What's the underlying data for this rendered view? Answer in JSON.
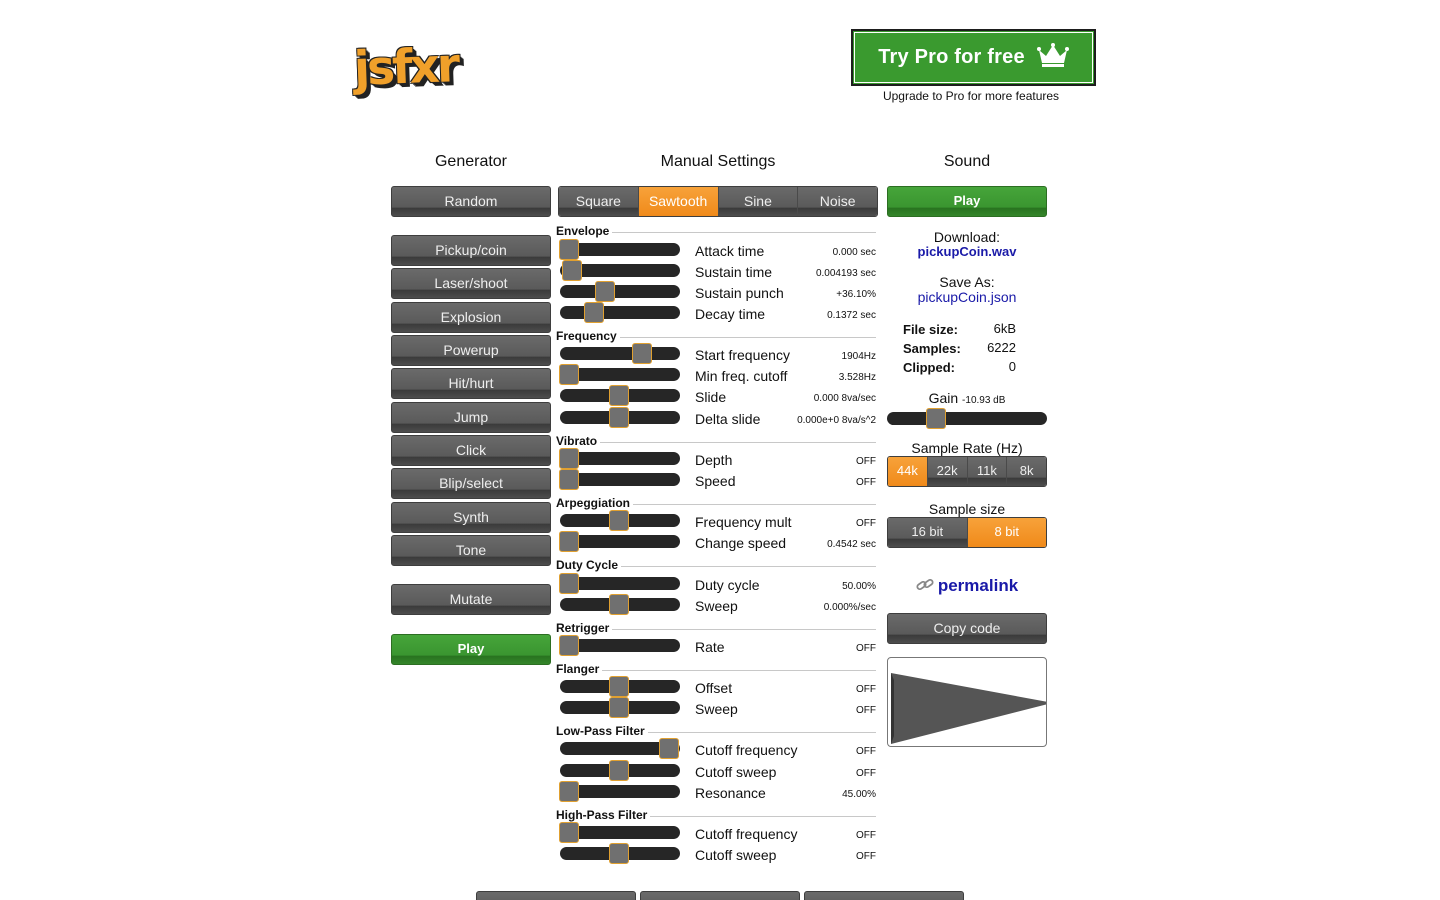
{
  "brand": {
    "logo_text": "jsfxr"
  },
  "pro": {
    "button_label": "Try Pro for free",
    "subtitle": "Upgrade to Pro for more features"
  },
  "headings": {
    "generator": "Generator",
    "manual": "Manual Settings",
    "sound": "Sound"
  },
  "generator": {
    "random": "Random",
    "presets": [
      "Pickup/coin",
      "Laser/shoot",
      "Explosion",
      "Powerup",
      "Hit/hurt",
      "Jump",
      "Click",
      "Blip/select",
      "Synth",
      "Tone"
    ],
    "mutate": "Mutate",
    "play": "Play"
  },
  "waveforms": {
    "options": [
      "Square",
      "Sawtooth",
      "Sine",
      "Noise"
    ],
    "selected": "Sawtooth"
  },
  "sections": {
    "envelope": "Envelope",
    "frequency": "Frequency",
    "vibrato": "Vibrato",
    "arpeggiation": "Arpeggiation",
    "duty": "Duty Cycle",
    "retrigger": "Retrigger",
    "flanger": "Flanger",
    "lpf": "Low-Pass Filter",
    "hpf": "High-Pass Filter"
  },
  "params": [
    {
      "label": "Attack time",
      "value": "0.000 sec",
      "level": 0.0
    },
    {
      "label": "Sustain time",
      "value": "0.004193 sec",
      "level": 0.03
    },
    {
      "label": "Sustain punch",
      "value": "+36.10%",
      "level": 0.36
    },
    {
      "label": "Decay time",
      "value": "0.1372 sec",
      "level": 0.25
    },
    {
      "label": "Start frequency",
      "value": "1904Hz",
      "level": 0.73
    },
    {
      "label": "Min freq. cutoff",
      "value": "3.528Hz",
      "level": 0.0
    },
    {
      "label": "Slide",
      "value": "0.000 8va/sec",
      "level": 0.5
    },
    {
      "label": "Delta slide",
      "value": "0.000e+0 8va/s^2",
      "level": 0.5
    },
    {
      "label": "Depth",
      "value": "OFF",
      "level": 0.0
    },
    {
      "label": "Speed",
      "value": "OFF",
      "level": 0.0
    },
    {
      "label": "Frequency mult",
      "value": "OFF",
      "level": 0.5
    },
    {
      "label": "Change speed",
      "value": "0.4542 sec",
      "level": 0.0
    },
    {
      "label": "Duty cycle",
      "value": "50.00%",
      "level": 0.0
    },
    {
      "label": "Sweep",
      "value": "0.000%/sec",
      "level": 0.5
    },
    {
      "label": "Rate",
      "value": "OFF",
      "level": 0.0
    },
    {
      "label": "Offset",
      "value": "OFF",
      "level": 0.5
    },
    {
      "label": "Sweep",
      "value": "OFF",
      "level": 0.5
    },
    {
      "label": "Cutoff frequency",
      "value": "OFF",
      "level": 1.0
    },
    {
      "label": "Cutoff sweep",
      "value": "OFF",
      "level": 0.5
    },
    {
      "label": "Resonance",
      "value": "45.00%",
      "level": 0.0
    },
    {
      "label": "Cutoff frequency",
      "value": "OFF",
      "level": 0.0
    },
    {
      "label": "Cutoff sweep",
      "value": "OFF",
      "level": 0.5
    }
  ],
  "sound": {
    "play": "Play",
    "download_label": "Download:",
    "download_file": "pickupCoin.wav",
    "saveas_label": "Save As:",
    "saveas_file": "pickupCoin.json",
    "stats": [
      {
        "key": "File size:",
        "value": "6kB"
      },
      {
        "key": "Samples:",
        "value": "6222"
      },
      {
        "key": "Clipped:",
        "value": "0"
      }
    ],
    "gain_label": "Gain",
    "gain_value": "-10.93 dB",
    "gain_level": 0.28,
    "sample_rate_label": "Sample Rate (Hz)",
    "sample_rates": [
      "44k",
      "22k",
      "11k",
      "8k"
    ],
    "sample_rate_selected": "44k",
    "sample_size_label": "Sample size",
    "sample_sizes": [
      "16 bit",
      "8 bit"
    ],
    "sample_size_selected": "8 bit",
    "permalink": "permalink",
    "copy_code": "Copy code"
  },
  "colors": {
    "accent": "#f08a1a",
    "play_green": "#3a9530",
    "link": "#1a1aa8",
    "button_gray": "#5a5a5a"
  },
  "icons": {
    "pro": "crown-icon",
    "permalink": "link-icon"
  }
}
